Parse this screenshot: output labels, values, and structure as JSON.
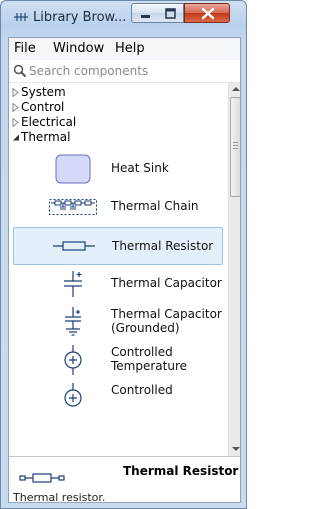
{
  "window": {
    "title": "Library Brow..."
  },
  "menu": [
    "File",
    "Window",
    "Help"
  ],
  "search": {
    "placeholder": "Search components"
  },
  "tree": {
    "categories": [
      {
        "label": "System",
        "expanded": false
      },
      {
        "label": "Control",
        "expanded": false
      },
      {
        "label": "Electrical",
        "expanded": false
      },
      {
        "label": "Thermal",
        "expanded": true
      }
    ],
    "components": [
      {
        "label": "Heat Sink",
        "icon": "heat-sink-icon"
      },
      {
        "label": "Thermal Chain",
        "icon": "thermal-chain-icon"
      },
      {
        "label": "Thermal Resistor",
        "icon": "thermal-resistor-icon",
        "selected": true
      },
      {
        "label": "Thermal Capacitor",
        "icon": "thermal-capacitor-icon"
      },
      {
        "label": "Thermal Capacitor (Grounded)",
        "label_lines": [
          "Thermal Capacitor",
          "(Grounded)"
        ],
        "icon": "thermal-capacitor-grounded-icon"
      },
      {
        "label": "Controlled Temperature",
        "label_lines": [
          "Controlled",
          "Temperature"
        ],
        "icon": "controlled-temperature-icon"
      },
      {
        "label": "Controlled",
        "icon": "controlled-icon"
      }
    ]
  },
  "details": {
    "title": "Thermal Resistor",
    "description": "Thermal resistor."
  },
  "colors": {
    "selection": "#e3f0fb",
    "selection_border": "#9dc4e6",
    "close_button": "#c2391c",
    "title_bar": "#c4d8ee",
    "icon_stroke": "#1a3e78",
    "heat_sink_fill": "#d6d8f7"
  }
}
